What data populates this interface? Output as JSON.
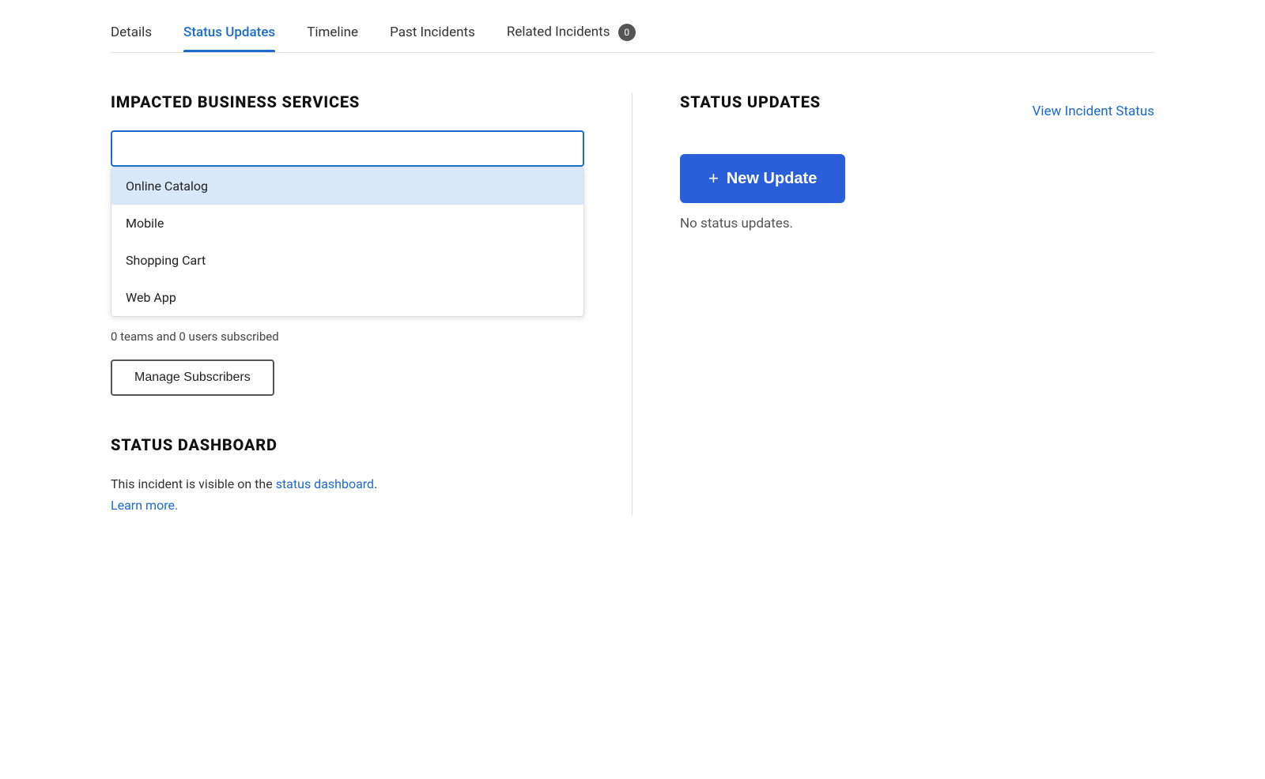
{
  "tabs": [
    {
      "id": "details",
      "label": "Details",
      "active": false
    },
    {
      "id": "status-updates",
      "label": "Status Updates",
      "active": true
    },
    {
      "id": "timeline",
      "label": "Timeline",
      "active": false
    },
    {
      "id": "past-incidents",
      "label": "Past Incidents",
      "active": false
    },
    {
      "id": "related-incidents",
      "label": "Related Incidents",
      "active": false,
      "badge": "0"
    }
  ],
  "left_panel": {
    "section_title": "IMPACTED BUSINESS SERVICES",
    "search_placeholder": "",
    "dropdown_items": [
      {
        "id": "online-catalog",
        "label": "Online Catalog",
        "highlighted": true
      },
      {
        "id": "mobile",
        "label": "Mobile",
        "highlighted": false
      },
      {
        "id": "shopping-cart",
        "label": "Shopping Cart",
        "highlighted": false
      },
      {
        "id": "web-app",
        "label": "Web App",
        "highlighted": false
      }
    ],
    "subscribers_text": "0 teams and 0 users subscribed",
    "manage_btn_label": "Manage Subscribers",
    "status_dashboard": {
      "title": "STATUS DASHBOARD",
      "description_prefix": "This incident is visible on the ",
      "link_text": "status dashboard",
      "description_suffix": ".",
      "learn_more": "Learn more."
    }
  },
  "right_panel": {
    "section_title": "STATUS UPDATES",
    "view_incident_link": "View Incident Status",
    "new_update_btn": "New Update",
    "no_updates_text": "No status updates."
  },
  "colors": {
    "active_tab": "#1a6bcc",
    "new_update_btn_bg": "#2b5fd9",
    "dropdown_highlight": "#d8e8f8",
    "badge_bg": "#555"
  }
}
